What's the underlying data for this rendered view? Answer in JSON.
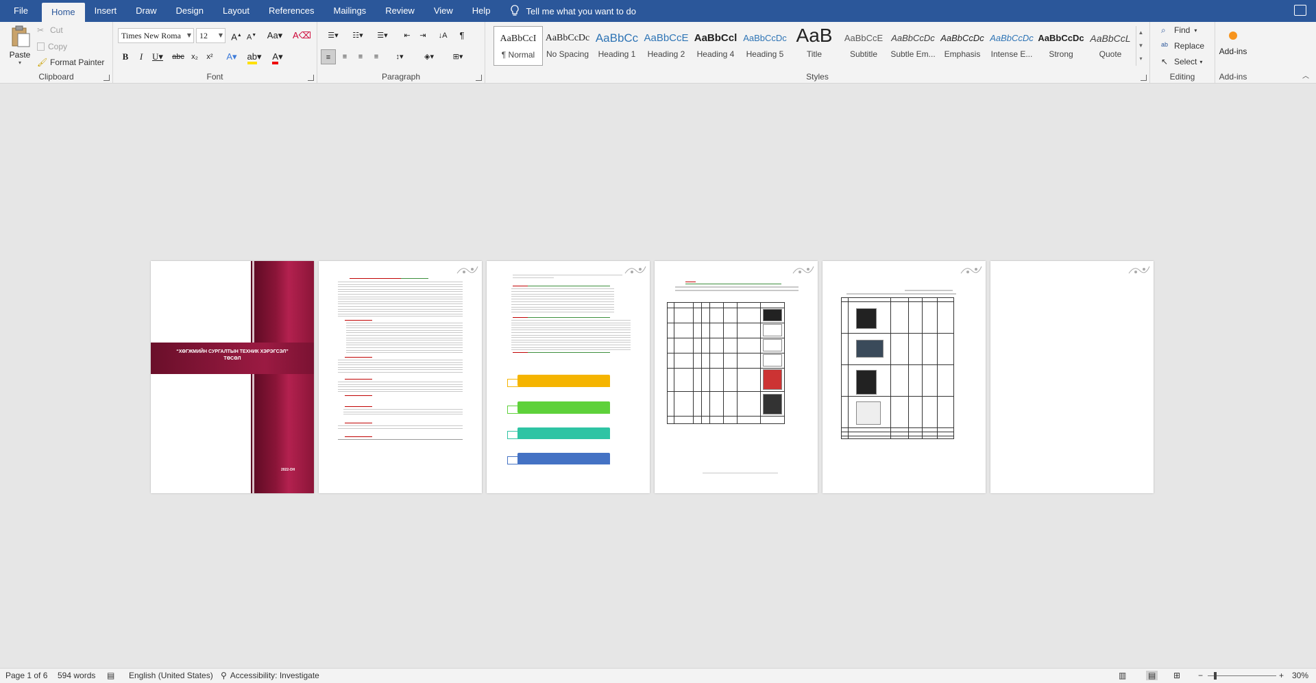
{
  "tabs": [
    "File",
    "Home",
    "Insert",
    "Draw",
    "Design",
    "Layout",
    "References",
    "Mailings",
    "Review",
    "View",
    "Help"
  ],
  "active_tab": "Home",
  "tell_me": "Tell me what you want to do",
  "clipboard": {
    "paste": "Paste",
    "cut": "Cut",
    "copy": "Copy",
    "format_painter": "Format Painter",
    "label": "Clipboard"
  },
  "font": {
    "name": "Times New Roma",
    "size": "12",
    "label": "Font"
  },
  "paragraph": {
    "label": "Paragraph"
  },
  "styles": {
    "label": "Styles",
    "items": [
      {
        "preview": "AaBbCcI",
        "name": "¶ Normal"
      },
      {
        "preview": "AaBbCcDc",
        "name": "No Spacing"
      },
      {
        "preview": "AaBbCc",
        "name": "Heading 1"
      },
      {
        "preview": "AaBbCcE",
        "name": "Heading 2"
      },
      {
        "preview": "AaBbCcl",
        "name": "Heading 4"
      },
      {
        "preview": "AaBbCcDc",
        "name": "Heading 5"
      },
      {
        "preview": "AaB",
        "name": "Title"
      },
      {
        "preview": "AaBbCcE",
        "name": "Subtitle"
      },
      {
        "preview": "AaBbCcDc",
        "name": "Subtle Em..."
      },
      {
        "preview": "AaBbCcDc",
        "name": "Emphasis"
      },
      {
        "preview": "AaBbCcDc",
        "name": "Intense E..."
      },
      {
        "preview": "AaBbCcDc",
        "name": "Strong"
      },
      {
        "preview": "AaBbCcL",
        "name": "Quote"
      }
    ]
  },
  "editing": {
    "find": "Find",
    "replace": "Replace",
    "select": "Select",
    "label": "Editing"
  },
  "addins": {
    "button": "Add-ins",
    "label": "Add-ins"
  },
  "document": {
    "cover_title": "“ХӨГЖМИЙН СУРГАЛТЫН ТЕХНИК ХЭРЭГСЭЛ” ТӨСӨЛ",
    "cover_year": "2022-ОН"
  },
  "status": {
    "page": "Page 1 of 6",
    "words": "594 words",
    "language": "English (United States)",
    "accessibility": "Accessibility: Investigate",
    "zoom": "30%"
  },
  "colors": {
    "title_bar": "#2b579a",
    "cover_band": "#8b1538"
  }
}
